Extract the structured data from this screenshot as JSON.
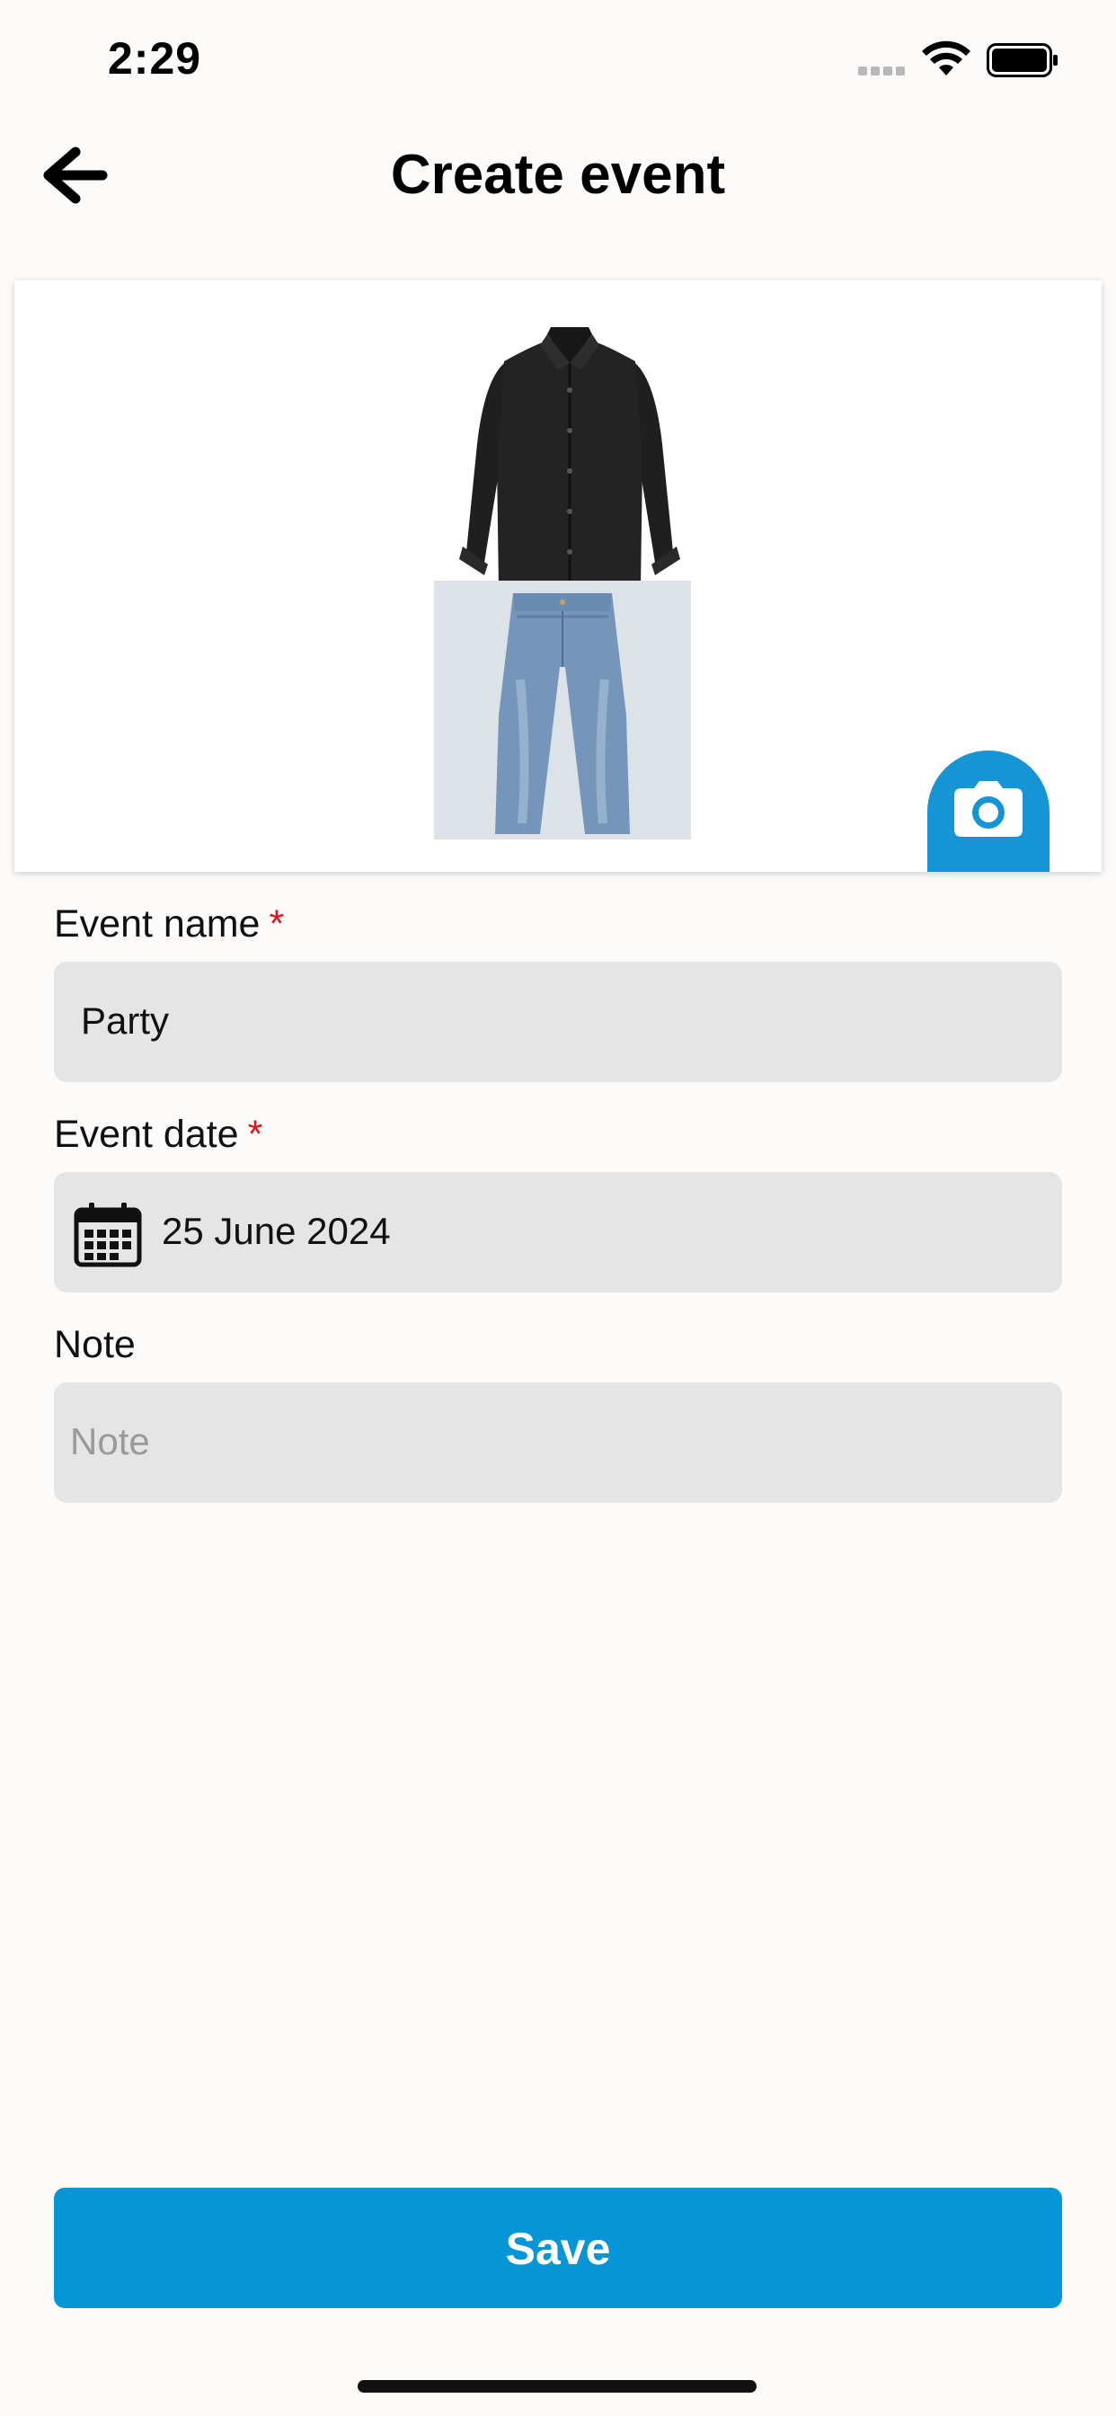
{
  "status_bar": {
    "time": "2:29"
  },
  "header": {
    "title": "Create event",
    "back_icon": "arrow-left-icon"
  },
  "outfit": {
    "items": [
      "shirt-image",
      "jeans-image"
    ],
    "camera_icon": "camera-icon"
  },
  "form": {
    "event_name": {
      "label": "Event name",
      "required_mark": "*",
      "value": "Party"
    },
    "event_date": {
      "label": "Event date",
      "required_mark": "*",
      "value": "25 June 2024",
      "icon": "calendar-icon"
    },
    "note": {
      "label": "Note",
      "placeholder": "Note",
      "value": ""
    }
  },
  "actions": {
    "save_label": "Save"
  },
  "colors": {
    "accent": "#0695D7",
    "camera_button": "#1594D6",
    "required": "#E0141E",
    "field_bg": "#E5E5E6",
    "background": "#FDFBF9"
  }
}
